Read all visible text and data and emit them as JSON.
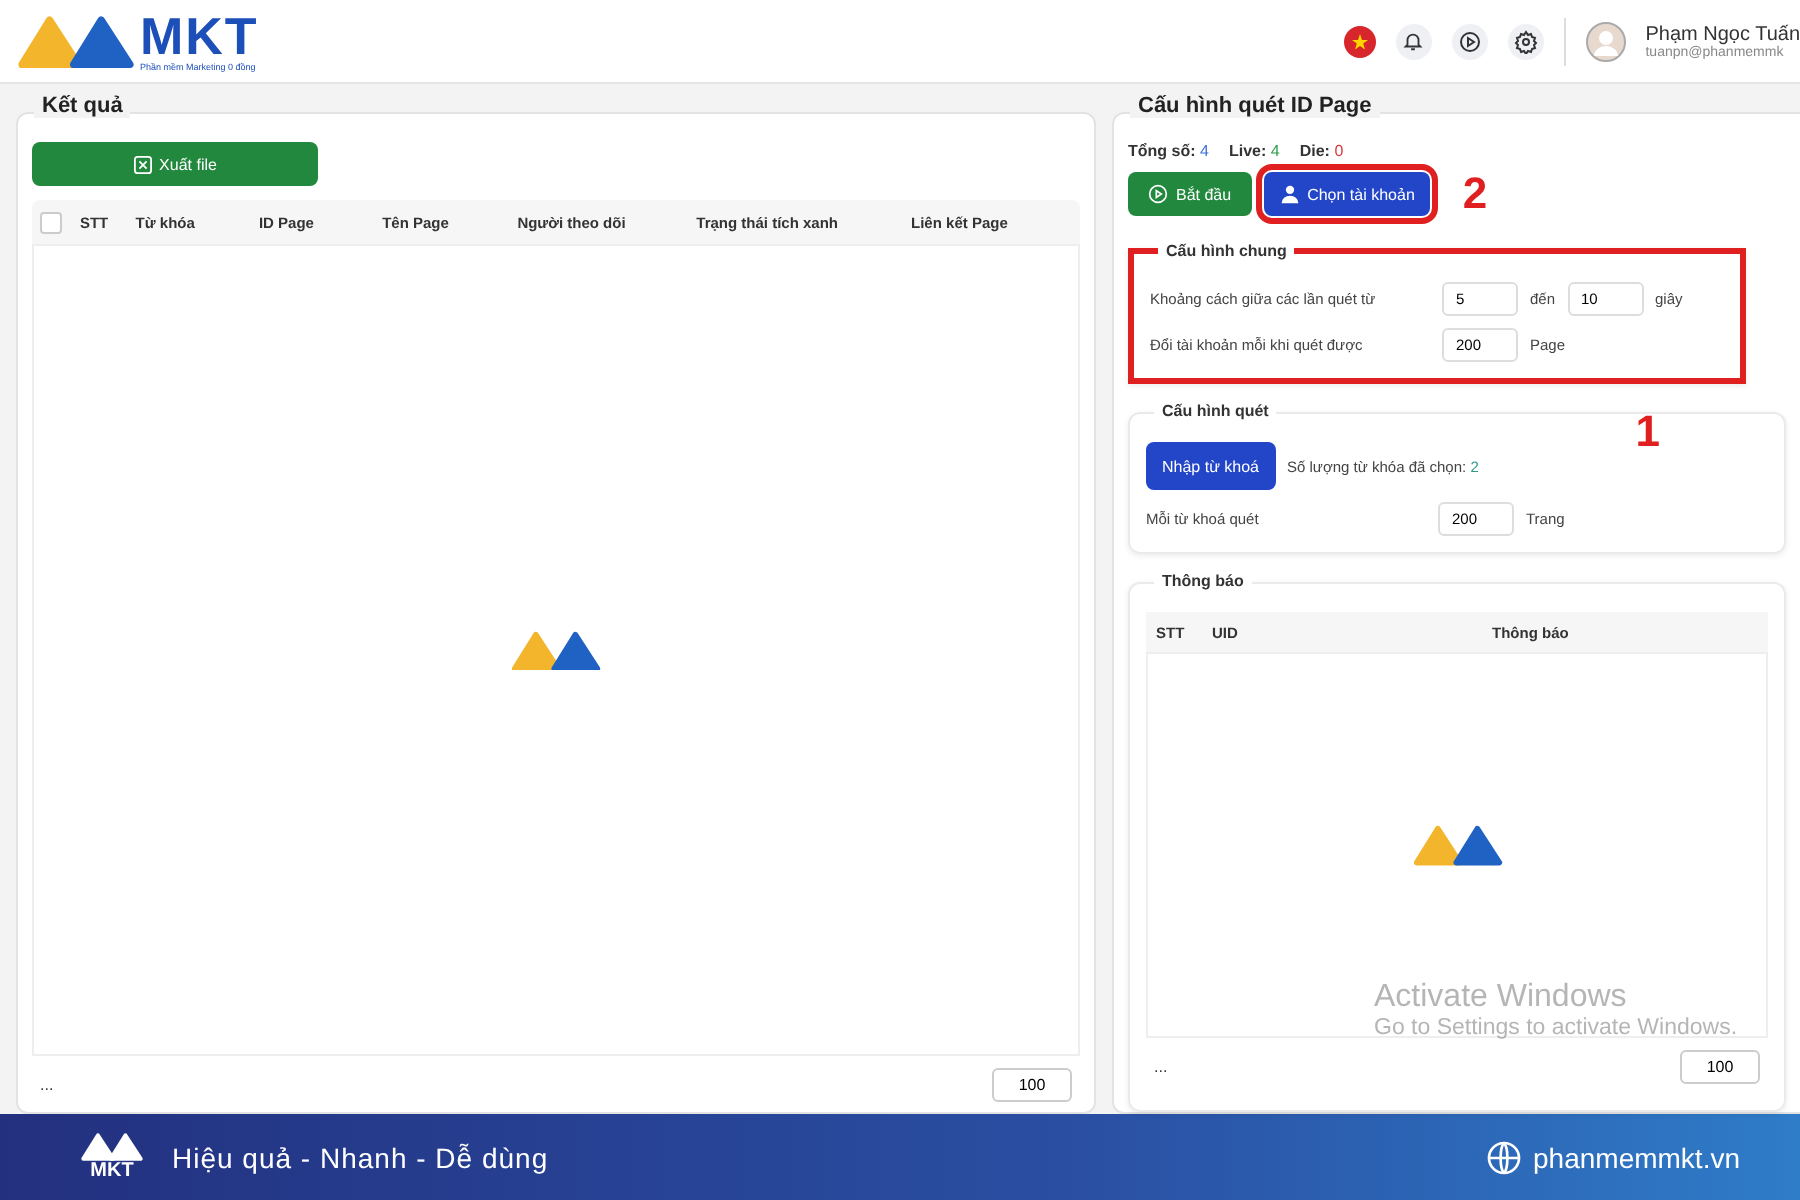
{
  "header": {
    "logo_text": "MKT",
    "logo_tagline": "Phần mềm Marketing 0 đồng",
    "user": {
      "name": "Phạm Ngọc Tuấn",
      "email": "tuanpn@phanmemmk"
    }
  },
  "results": {
    "title": "Kết quả",
    "export_button": "Xuất file",
    "select_all_checked": false,
    "columns": [
      "STT",
      "Từ khóa",
      "ID Page",
      "Tên Page",
      "Người theo dõi",
      "Trạng thái tích xanh",
      "Liên kết Page"
    ],
    "footer_text": "...",
    "page_size": "100"
  },
  "config": {
    "title": "Cấu hình quét ID Page",
    "stats": [
      {
        "label": "Tổng số:",
        "value": "4",
        "color": "#3b6fd8"
      },
      {
        "label": "Live:",
        "value": "4",
        "color": "#2e9a4a"
      },
      {
        "label": "Die:",
        "value": "0",
        "color": "#d93a3a"
      }
    ],
    "start_button": "Bắt đầu",
    "account_button": {
      "label": "Chọn tài khoản",
      "highlighted": true,
      "annotation": "2"
    },
    "general": {
      "title": "Cấu hình chung",
      "highlighted": true,
      "annotation": "1",
      "rows": [
        {
          "label": "Khoảng cách giữa các lần quét từ",
          "parts": [
            {
              "kind": "input",
              "value": "5"
            },
            {
              "kind": "text",
              "text": "đến"
            },
            {
              "kind": "input",
              "value": "10"
            },
            {
              "kind": "text",
              "text": "giây"
            }
          ]
        },
        {
          "label": "Đổi tài khoản mỗi khi quét được",
          "parts": [
            {
              "kind": "input",
              "value": "200"
            },
            {
              "kind": "text",
              "text": "Page"
            }
          ]
        }
      ]
    },
    "scan": {
      "title": "Cấu hình quét",
      "keyword_button": "Nhập từ khoá",
      "count_label": "Số lượng từ khóa đã chọn:",
      "count_value": "2",
      "row": {
        "label": "Mỗi từ khoá quét",
        "value": "200",
        "unit": "Trang"
      }
    },
    "notifications": {
      "title": "Thông báo",
      "columns": [
        "STT",
        "UID",
        "Thông báo"
      ],
      "footer_text": "...",
      "page_size": "100"
    }
  },
  "os_watermark": {
    "title": "Activate Windows",
    "subtitle": "Go to Settings to activate Windows."
  },
  "banner": {
    "logo_text": "MKT",
    "slogan": "Hiệu quả - Nhanh - Dễ dùng",
    "website": "phanmemmkt.vn"
  }
}
